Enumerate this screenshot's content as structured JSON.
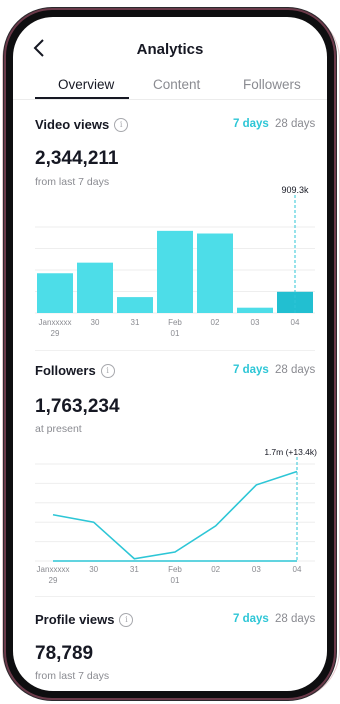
{
  "header": {
    "title": "Analytics"
  },
  "tabs": [
    {
      "label": "Overview",
      "active": true
    },
    {
      "label": "Content",
      "active": false
    },
    {
      "label": "Followers",
      "active": false
    }
  ],
  "info_icon_glyph": "i",
  "video_views": {
    "title": "Video views",
    "range_active": "7 days",
    "range_other": "28 days",
    "value": "2,344,211",
    "subtext": "from last 7 days",
    "highlight_label": "909.3k"
  },
  "followers": {
    "title": "Followers",
    "range_active": "7 days",
    "range_other": "28 days",
    "value": "1,763,234",
    "subtext": "at present",
    "highlight_label": "1.7m (+13.4k)"
  },
  "profile_views": {
    "title": "Profile views",
    "range_active": "7 days",
    "range_other": "28 days",
    "value": "78,789",
    "subtext": "from last 7 days"
  },
  "colors": {
    "accent": "#2dc6d6",
    "bar": "#4ddde8",
    "bar_highlight": "#22bfd1",
    "grid": "#eeeeee",
    "muted": "#8a8b91"
  },
  "chart_data": [
    {
      "type": "bar",
      "categories": [
        "Janxxxxx 29",
        "30",
        "31",
        "Feb 01",
        "02",
        "03",
        "04"
      ],
      "values": [
        300000,
        380000,
        120000,
        620000,
        600000,
        40000,
        160000
      ],
      "highlight_index": 6,
      "ylim": [
        0,
        800000
      ],
      "grid": true
    },
    {
      "type": "line",
      "categories": [
        "Janxxxxx 29",
        "30",
        "31",
        "Feb 01",
        "02",
        "03",
        "04"
      ],
      "series": [
        {
          "values": [
            0.62,
            0.52,
            0.03,
            0.12,
            0.47,
            1.02,
            1.2
          ]
        },
        {
          "values": [
            0,
            0,
            0,
            0,
            0,
            0,
            0
          ]
        }
      ],
      "highlight_index": 6,
      "ylim": [
        0,
        1.3
      ],
      "grid": true
    }
  ]
}
